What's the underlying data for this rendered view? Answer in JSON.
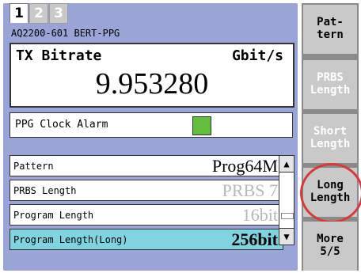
{
  "tabs": [
    "1",
    "2",
    "3"
  ],
  "instrument_title": "AQ2200-601 BERT-PPG",
  "bitrate": {
    "label": "TX Bitrate",
    "unit": "Gbit/s",
    "value": "9.953280"
  },
  "alarm": {
    "label": "PPG Clock Alarm",
    "led_color": "#62bd3c"
  },
  "list": [
    {
      "label": "Pattern",
      "value": "Prog64M",
      "state": "normal"
    },
    {
      "label": "PRBS Length",
      "value": "PRBS 7",
      "state": "disabled"
    },
    {
      "label": "Program Length",
      "value": "16bit",
      "state": "disabled"
    },
    {
      "label": "Program Length(Long)",
      "value": "256bit",
      "state": "selected"
    }
  ],
  "softkeys": [
    {
      "label": "Pat-\ntern",
      "state": "active"
    },
    {
      "label": "PRBS\nLength",
      "state": "disabled"
    },
    {
      "label": "Short\nLength",
      "state": "disabled"
    },
    {
      "label": "Long\nLength",
      "state": "active",
      "highlighted": true
    },
    {
      "label": "More\n5/5",
      "state": "active"
    }
  ],
  "scrollbar": {
    "up_icon": "triangle-up",
    "down_icon": "triangle-down"
  }
}
